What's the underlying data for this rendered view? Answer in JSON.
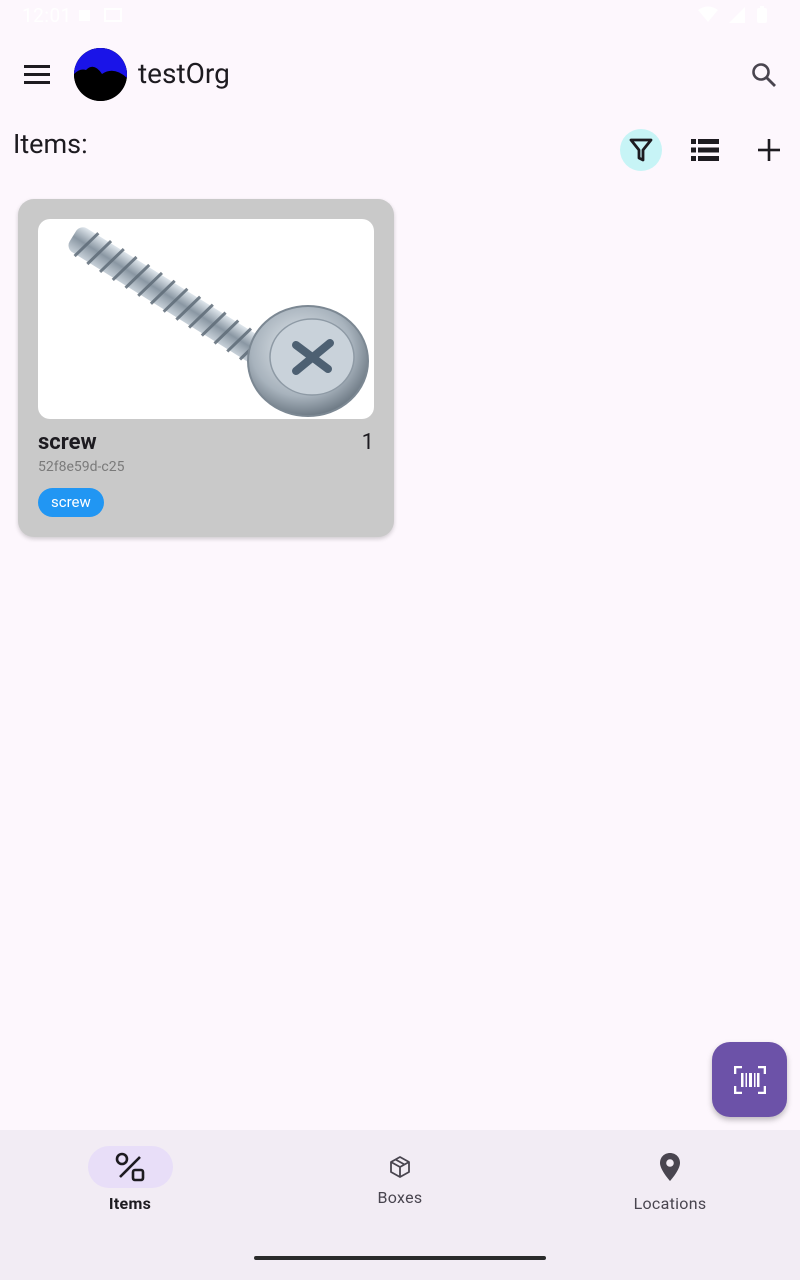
{
  "status_bar": {
    "time": "12:01"
  },
  "app_bar": {
    "org_name": "testOrg"
  },
  "items_section": {
    "header": "Items:"
  },
  "items": [
    {
      "name": "screw",
      "quantity": "1",
      "id": "52f8e59d-c25",
      "tag": "screw"
    }
  ],
  "bottom_nav": {
    "items_label": "Items",
    "boxes_label": "Boxes",
    "locations_label": "Locations"
  },
  "colors": {
    "background": "#fdf7fd",
    "filter_active": "#c7f4f6",
    "card": "#c9c9c9",
    "tag": "#2196f3",
    "fab": "#6c52a8",
    "nav_active_pill": "#e8def8",
    "nav_background": "#f2ecf4"
  },
  "icons": {
    "menu": "menu-icon",
    "search": "search-icon",
    "filter": "filter-icon",
    "list_view": "list-view-icon",
    "add": "add-icon",
    "barcode_scan": "barcode-scan-icon",
    "items_nav": "shapes-icon",
    "boxes_nav": "box-icon",
    "locations_nav": "location-pin-icon"
  }
}
